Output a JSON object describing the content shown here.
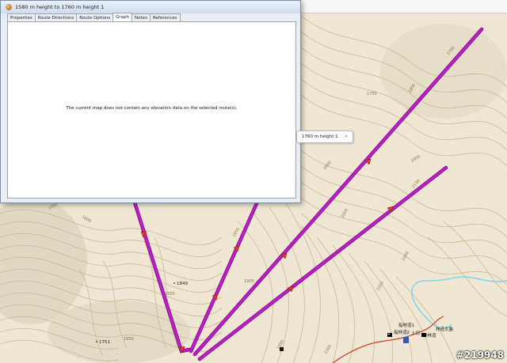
{
  "window": {
    "title": "1580 m height to 1760 m height 1",
    "tabs": [
      {
        "label": "Properties"
      },
      {
        "label": "Route Directions"
      },
      {
        "label": "Route Options"
      },
      {
        "label": "Graph"
      },
      {
        "label": "Notes"
      },
      {
        "label": "References"
      }
    ],
    "active_tab": "Graph",
    "message": "The current map does not contain any elevation data on the selected route(s)."
  },
  "route_tooltip": {
    "text": "1760 m height 1",
    "close": "×"
  },
  "contour_labels": [
    "1700",
    "1750",
    "1800",
    "1850",
    "1900",
    "1950",
    "2000",
    "2050",
    "2100",
    "1650",
    "1600",
    "1550",
    "1500",
    "2150",
    "2200"
  ],
  "poi_labels": [
    "1849",
    "1751",
    "1760",
    "1550"
  ],
  "places": [
    "指林道1",
    "指林道2",
    "上切",
    "林道文盤",
    "美林道"
  ],
  "watermark": "#219948",
  "colors": {
    "route": "#c41bd0",
    "route_dark": "#6a0b74",
    "arrow": "#e03a1b",
    "stream": "#6fd5ee",
    "trail": "#c83c24",
    "contour": "#c9b28d"
  }
}
